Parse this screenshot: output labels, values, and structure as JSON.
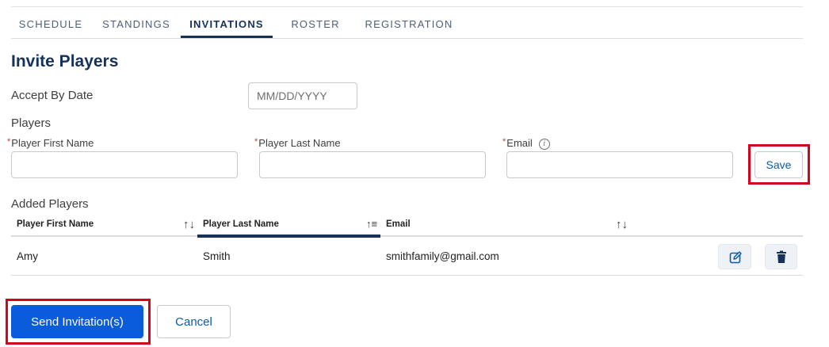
{
  "tabs": [
    {
      "label": "SCHEDULE",
      "active": false
    },
    {
      "label": "STANDINGS",
      "active": false
    },
    {
      "label": "INVITATIONS",
      "active": true
    },
    {
      "label": "ROSTER",
      "active": false
    },
    {
      "label": "REGISTRATION",
      "active": false
    }
  ],
  "page": {
    "title": "Invite Players",
    "accept_by_label": "Accept By Date",
    "accept_by_placeholder": "MM/DD/YYYY",
    "players_label": "Players",
    "required_mark": "*",
    "first_name_label": "Player First Name",
    "last_name_label": "Player Last Name",
    "email_label": "Email",
    "info_icon": "info-icon",
    "save_label": "Save",
    "added_players_label": "Added Players"
  },
  "table": {
    "columns": [
      "Player First Name",
      "Player Last Name",
      "Email"
    ],
    "sort_icon": "↑↓",
    "sorted_icon": "↑≡",
    "rows": [
      {
        "first": "Amy",
        "last": "Smith",
        "email": "smithfamily@gmail.com"
      }
    ]
  },
  "footer": {
    "send_label": "Send Invitation(s)",
    "cancel_label": "Cancel"
  },
  "colors": {
    "brand": "#16325c",
    "primary_button": "#0b5cdb",
    "highlight": "#d1051c"
  }
}
